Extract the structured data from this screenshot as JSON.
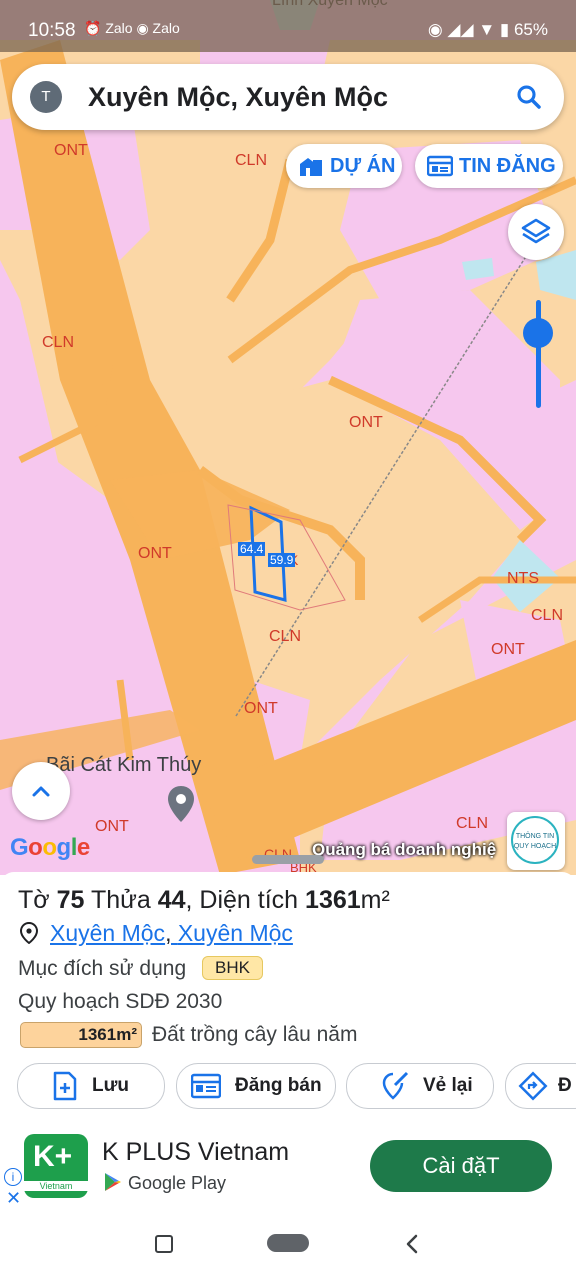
{
  "status_bar": {
    "time": "10:58",
    "app_icons": "⏰ Zalo ◉ Zalo",
    "battery": "65%",
    "partial_top_text": "Lính Xuyên Mộc"
  },
  "search": {
    "avatar_letter": "T",
    "query": "Xuyên Mộc, Xuyên Mộc"
  },
  "map_buttons": {
    "du_an": "DỰ ÁN",
    "tin_dang": "TIN ĐĂNG"
  },
  "map": {
    "zone_labels": [
      "ONT",
      "CLN",
      "CLN",
      "ONT",
      "ONT",
      "CLN",
      "NTS",
      "CLN",
      "ONT",
      "ONT",
      "ONT",
      "CLN",
      "CLN",
      "BHK",
      "K"
    ],
    "parcel_dims": [
      "64.4",
      "59.9"
    ],
    "poi_name": "Bãi Cát Kim Thúy",
    "google_logo": "Google",
    "promo_text": "Quảng bá doanh nghiệ",
    "qh_badge": "THÔNG TIN QUY HOẠCH"
  },
  "parcel": {
    "to_label": "Tờ",
    "to_value": "75",
    "thua_label": "Thửa",
    "thua_value": "44",
    "dt_label": ", Diện tích",
    "dt_value": "1361",
    "dt_unit": "m²",
    "location_part1": "Xuyên Mộc",
    "location_sep": ", ",
    "location_part2": "Xuyên Mộc",
    "purpose_label": "Mục đích sử dụng",
    "purpose_code": "BHK",
    "plan_label": "Quy hoạch SDĐ 2030",
    "plan_area": "1361m²",
    "plan_landuse": "Đất trồng cây lâu năm"
  },
  "actions": {
    "save": "Lưu",
    "post": "Đăng bán",
    "redraw": "Vẻ lại",
    "directions": "Đ"
  },
  "ad": {
    "logo_text": "K+",
    "logo_sub": "Vietnam",
    "name": "K PLUS Vietnam",
    "store": "Google Play",
    "cta": "Cài đặT"
  },
  "colors": {
    "map_pink": "#f6c7ee",
    "map_orange": "#fbd7a6",
    "road": "#f7b35a",
    "accent_blue": "#1a73e8",
    "ad_green": "#1e7a4a"
  }
}
